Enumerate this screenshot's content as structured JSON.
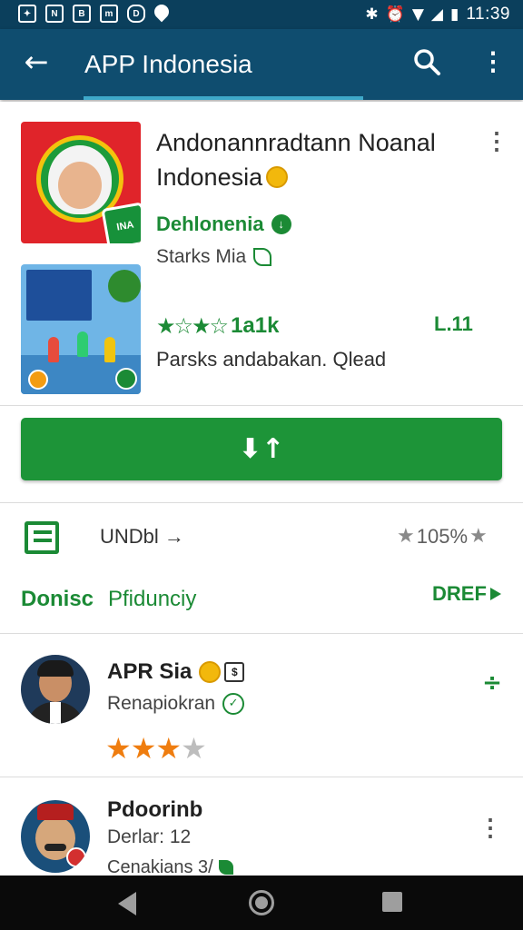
{
  "status_bar": {
    "time": "11:39",
    "left_icons": [
      "photo-icon",
      "notification-icon",
      "sim-icon",
      "gallery-icon",
      "media-icon",
      "location-icon"
    ],
    "right_icons": [
      "bluetooth-icon",
      "alarm-icon",
      "wifi-icon",
      "signal-icon",
      "battery-icon"
    ]
  },
  "app_bar": {
    "title": "APP Indonesia",
    "back_icon": "arrow-back-icon",
    "search_icon": "search-icon",
    "more_icon": "more-vert-icon"
  },
  "app": {
    "name": "Andonannradtann Noanal Indonesia",
    "developer": "Dehlonenia",
    "subtitle": "Starks Mia",
    "rating_text": "1a1k",
    "rating_stars": "★☆★☆",
    "rating_right": "L.11",
    "description": "Parsks andabakan. Qlead",
    "icon_badge_text": "INA"
  },
  "install_button": {
    "icon": "download-icon"
  },
  "section": {
    "label": "UNDbl",
    "percent": "105%",
    "tab_left": "Donisc",
    "tab_mid": "Pfidunciy",
    "more_label": "DREF"
  },
  "reviews": [
    {
      "name": "APR Sia",
      "subtitle": "Renapiokran",
      "stars_on": "★★★",
      "stars_off": "★",
      "rating": 3
    },
    {
      "name": "Pdoorinb",
      "subtitle": "Derlar: 12",
      "footer": "Cenakians 3/"
    }
  ],
  "colors": {
    "app_bar": "#0f4d6f",
    "status_bar": "#0b3f5c",
    "accent_green": "#1d9438",
    "star_orange": "#ef7d0f"
  }
}
